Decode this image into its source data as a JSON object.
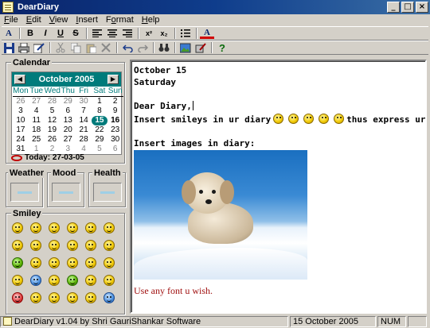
{
  "window": {
    "title": "DearDiary",
    "controls": [
      "_",
      "□",
      "×"
    ]
  },
  "menu": [
    {
      "label": "File",
      "accel": "F"
    },
    {
      "label": "Edit",
      "accel": "E"
    },
    {
      "label": "View",
      "accel": "V"
    },
    {
      "label": "Insert",
      "accel": "I"
    },
    {
      "label": "Format",
      "accel": "o"
    },
    {
      "label": "Help",
      "accel": "H"
    }
  ],
  "toolbar_format": {
    "font": "A",
    "bold": "B",
    "italic": "I",
    "underline": "U",
    "strike": "S",
    "superscript": "x²",
    "subscript": "x₂",
    "font_color": "A"
  },
  "sidebar": {
    "calendar_label": "Calendar",
    "month": "October 2005",
    "weekdays": [
      "Mon",
      "Tue",
      "Wed",
      "Thu",
      "Fri",
      "Sat",
      "Sun"
    ],
    "days": [
      [
        {
          "d": "26",
          "o": true
        },
        {
          "d": "27",
          "o": true
        },
        {
          "d": "28",
          "o": true
        },
        {
          "d": "29",
          "o": true
        },
        {
          "d": "30",
          "o": true
        },
        {
          "d": "1"
        },
        {
          "d": "2"
        }
      ],
      [
        {
          "d": "3"
        },
        {
          "d": "4"
        },
        {
          "d": "5"
        },
        {
          "d": "6"
        },
        {
          "d": "7"
        },
        {
          "d": "8"
        },
        {
          "d": "9"
        }
      ],
      [
        {
          "d": "10"
        },
        {
          "d": "11"
        },
        {
          "d": "12"
        },
        {
          "d": "13"
        },
        {
          "d": "14"
        },
        {
          "d": "15",
          "sel": true
        },
        {
          "d": "16",
          "b": true
        }
      ],
      [
        {
          "d": "17"
        },
        {
          "d": "18"
        },
        {
          "d": "19"
        },
        {
          "d": "20"
        },
        {
          "d": "21"
        },
        {
          "d": "22"
        },
        {
          "d": "23"
        }
      ],
      [
        {
          "d": "24"
        },
        {
          "d": "25"
        },
        {
          "d": "26"
        },
        {
          "d": "27"
        },
        {
          "d": "28"
        },
        {
          "d": "29"
        },
        {
          "d": "30"
        }
      ],
      [
        {
          "d": "31"
        },
        {
          "d": "1",
          "o": true
        },
        {
          "d": "2",
          "o": true
        },
        {
          "d": "3",
          "o": true
        },
        {
          "d": "4",
          "o": true
        },
        {
          "d": "5",
          "o": true
        },
        {
          "d": "6",
          "o": true
        }
      ]
    ],
    "today_text": "Today: 27-03-05",
    "weather_label": "Weather",
    "mood_label": "Mood",
    "health_label": "Health",
    "smiley_label": "Smiley"
  },
  "editor": {
    "date_line": "October 15",
    "day_line": "Saturday",
    "greeting": "Dear Diary,",
    "smiley_text_before": "Insert smileys in ur diary",
    "smiley_text_after": "thus express urself better!",
    "images_heading": "Insert images in diary:",
    "font_line": "Use any font u wish."
  },
  "status": {
    "app_text": "DearDiary v1.04 by Shri GauriShankar Software",
    "date": "15 October 2005",
    "num": "NUM"
  },
  "colors": {
    "titlebar": "#0a246a",
    "calendar_header": "#007b7b",
    "font_sample": "#a01010"
  }
}
